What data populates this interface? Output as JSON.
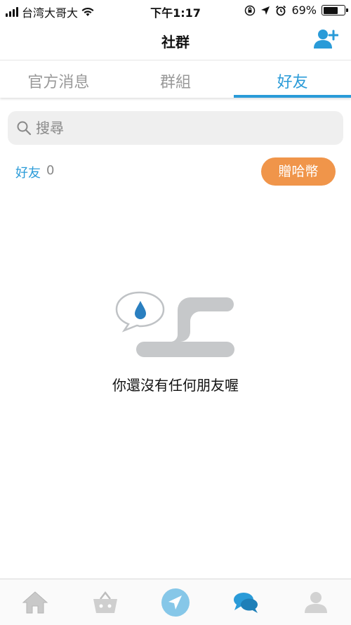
{
  "status_bar": {
    "carrier": "台湾大哥大",
    "time": "下午1:17",
    "battery": "69%",
    "battery_level": 0.69
  },
  "header": {
    "title": "社群",
    "add_friend_icon": "add-user-icon"
  },
  "tabs": [
    {
      "label": "官方消息",
      "active": false
    },
    {
      "label": "群組",
      "active": false
    },
    {
      "label": "好友",
      "active": true
    }
  ],
  "search": {
    "placeholder": "搜尋"
  },
  "friends": {
    "label": "好友",
    "count": "0",
    "gift_button_label": "贈哈幣"
  },
  "empty_state": {
    "message": "你還沒有任何朋友喔"
  },
  "bottom_nav": [
    {
      "icon": "home-icon",
      "active": false
    },
    {
      "icon": "basket-icon",
      "active": false
    },
    {
      "icon": "send-icon",
      "active": false
    },
    {
      "icon": "chat-bubbles-icon",
      "active": true
    },
    {
      "icon": "profile-icon",
      "active": false
    }
  ],
  "colors": {
    "accent": "#2a9bd8",
    "gift_button": "#f0954a",
    "inactive_tab": "#999999",
    "search_bg": "#efefef"
  }
}
